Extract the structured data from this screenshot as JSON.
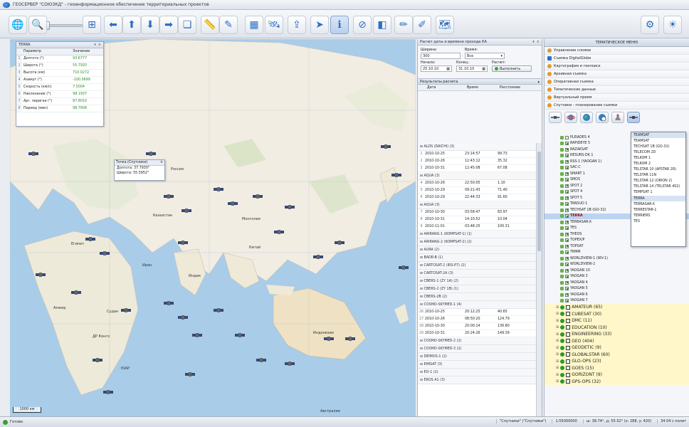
{
  "window": {
    "title": "ГЕОСЕРВЕР \"СОЮЗКД\" - геоинформационное обеспечение территориальных проектов"
  },
  "colors": {
    "accent": "#2e6fc0",
    "selected_text": "#b00000",
    "value_green": "#2a8a2a",
    "highlight_row": "#bcd3f2"
  },
  "toolbar": {
    "icons": [
      "globe-icon",
      "zoom-icon",
      "zoom-extent-icon",
      "arrow-left-icon",
      "arrow-up-icon",
      "arrow-down-icon",
      "arrow-right-icon",
      "layers-icon",
      "ruler-icon",
      "measure-icon",
      "grid-icon",
      "satellite-icon",
      "export-icon",
      "send-icon",
      "info-icon",
      "cancel-icon",
      "overlay-icon",
      "draw-icon",
      "map-edit-icon",
      "map-icon",
      "config-icon",
      "weather-icon"
    ]
  },
  "sat_panel": {
    "title": "TERRA",
    "col_param": "Параметр",
    "col_value": "Значение",
    "rows": [
      {
        "idx": "1",
        "param": "Долгота (°)",
        "value": "93.6777"
      },
      {
        "idx": "2",
        "param": "Широта (°)",
        "value": "55.7920"
      },
      {
        "idx": "3",
        "param": "Высота (км)",
        "value": "710.0272"
      },
      {
        "idx": "4",
        "param": "Азимут (°)",
        "value": "-100.0699"
      },
      {
        "idx": "5",
        "param": "Скорость (км/с)",
        "value": "7.5004"
      },
      {
        "idx": "6",
        "param": "Наклонение (°)",
        "value": "98.1937"
      },
      {
        "idx": "7",
        "param": "Арг. перигея (°)",
        "value": "87.8010"
      },
      {
        "idx": "8",
        "param": "Период (мин)",
        "value": "98.7608"
      }
    ]
  },
  "tooltip": {
    "title": "Точка (Спутники)",
    "line1": "Долгота: 37.7930°",
    "line2": "Широта: 55.5952°"
  },
  "map": {
    "scale": "1000 км",
    "places": [
      "Россия",
      "Казахстан",
      "Монголия",
      "Китай",
      "Индия",
      "Индонезия",
      "Австралия",
      "Египет",
      "Алжир",
      "ДР Конго",
      "Судан",
      "ЮАР",
      "Иран"
    ]
  },
  "calc_panel": {
    "title": "Расчет даты и времени прохода КА",
    "width_label": "Ширина:",
    "width_value": "300",
    "time_label": "Время:",
    "time_value": "Все",
    "start_label": "Начало:",
    "start_value": "25.10.10",
    "end_label": "Конец:",
    "end_value": "31.10.10",
    "calc_label": "Расчет:",
    "calc_button": "Выполнить",
    "results_title": "Результаты расчета",
    "col_date": "Дата",
    "col_time": "Время",
    "col_dist": "Расстояние",
    "results": [
      {
        "group": "ALOS (DAICHI) (3)",
        "rows": [
          [
            "1",
            "2010-10-25",
            "23:14:57",
            "99.73"
          ],
          [
            "2",
            "2010-10-26",
            "12:43:12",
            "35.32"
          ],
          [
            "3",
            "2010-10-31",
            "12:45:08",
            "67.08"
          ]
        ]
      },
      {
        "group": "AQUA (3)",
        "rows": [
          [
            "4",
            "2010-10-26",
            "22:50:05",
            "1.10"
          ],
          [
            "5",
            "2010-10-29",
            "09:21:43",
            "71.40"
          ],
          [
            "6",
            "2010-10-29",
            "22:44:33",
            "91.60"
          ]
        ]
      },
      {
        "group": "AQUA (3)",
        "rows": [
          [
            "7",
            "2010-10-30",
            "03:58:47",
            "83.97"
          ],
          [
            "8",
            "2010-10-31",
            "14:10:52",
            "10.04"
          ],
          [
            "9",
            "2010-11-01",
            "03:48:25",
            "100.31"
          ]
        ]
      },
      {
        "group": "ARIRANG-1 (KOMPSAT-1) (1)",
        "rows": []
      },
      {
        "group": "ARIRANG-2 (KOMPSAT-2) (2)",
        "rows": []
      },
      {
        "group": "AURA (2)",
        "rows": []
      },
      {
        "group": "BADR-B (1)",
        "rows": []
      },
      {
        "group": "CARTOSAT-2 (IRS-P7) (2)",
        "rows": []
      },
      {
        "group": "CARTOSAT-2A (3)",
        "rows": []
      },
      {
        "group": "CBERS-1 (ZY 1A) (2)",
        "rows": []
      },
      {
        "group": "CBERS-2 (ZY 1B) (1)",
        "rows": []
      },
      {
        "group": "CBERS-2B (2)",
        "rows": []
      },
      {
        "group": "COSMO-SKYMED-1 (4)",
        "rows": [
          [
            "26",
            "2010-10-25",
            "20:12:25",
            "40.65"
          ],
          [
            "27",
            "2010-10-26",
            "08:50:20",
            "124.79"
          ],
          [
            "28",
            "2010-10-30",
            "20:00:14",
            "136.80"
          ],
          [
            "29",
            "2010-10-31",
            "20:24:26",
            "149.39"
          ]
        ]
      },
      {
        "group": "COSMO-SKYMED-2 (2)",
        "rows": []
      },
      {
        "group": "COSMO-SKYMED-3 (2)",
        "rows": []
      },
      {
        "group": "DEIMOS-1 (2)",
        "rows": []
      },
      {
        "group": "EMISAT (3)",
        "rows": []
      },
      {
        "group": "EO-1 (2)",
        "rows": []
      },
      {
        "group": "EROS A1 (3)",
        "rows": []
      }
    ]
  },
  "theme_panel": {
    "title": "ТЕМАТИЧЕСКОЕ МЕНЮ",
    "menu": [
      {
        "label": "Управление слоями",
        "icon": "orange"
      },
      {
        "label": "Съемка DigitalGlobe",
        "icon": "blue"
      },
      {
        "label": "Картография и геопоиск",
        "icon": "orange"
      },
      {
        "label": "Архивная съемка",
        "icon": "orange"
      },
      {
        "label": "Оперативная съемка",
        "icon": "orange"
      },
      {
        "label": "Тематические данные",
        "icon": "orange"
      },
      {
        "label": "Виртуальный прием",
        "icon": "orange"
      },
      {
        "label": "Спутники - планирование съемки",
        "icon": "orange"
      }
    ],
    "tree_items": [
      {
        "label": "PLEIADES 4",
        "checked": false,
        "selected": false
      },
      {
        "label": "RAPIDEYE 5",
        "checked": true,
        "selected": false
      },
      {
        "label": "RAZAKSAT",
        "checked": true,
        "selected": false
      },
      {
        "label": "RESURS-DK 1",
        "checked": true,
        "selected": false
      },
      {
        "label": "RSS-1 (YAOGAN 1)",
        "checked": true,
        "selected": false
      },
      {
        "label": "SAC-C",
        "checked": true,
        "selected": false
      },
      {
        "label": "SMART 1",
        "checked": true,
        "selected": false
      },
      {
        "label": "SMOS",
        "checked": true,
        "selected": false
      },
      {
        "label": "SPOT 2",
        "checked": true,
        "selected": false
      },
      {
        "label": "SPOT 4",
        "checked": true,
        "selected": false
      },
      {
        "label": "SPOT 5",
        "checked": true,
        "selected": false
      },
      {
        "label": "TANSUO 1",
        "checked": true,
        "selected": false
      },
      {
        "label": "TECHSAT 1B (GO-32)",
        "checked": true,
        "selected": false
      },
      {
        "label": "TERRA",
        "checked": true,
        "selected": true
      },
      {
        "label": "TERRASAR-X",
        "checked": true,
        "selected": false
      },
      {
        "label": "TES",
        "checked": true,
        "selected": false
      },
      {
        "label": "THEOS",
        "checked": true,
        "selected": false
      },
      {
        "label": "TOPEX/P",
        "checked": true,
        "selected": false
      },
      {
        "label": "TOPSAT",
        "checked": true,
        "selected": false
      },
      {
        "label": "TRMM",
        "checked": true,
        "selected": false
      },
      {
        "label": "WORLDVIEW-1 (WV-1)",
        "checked": true,
        "selected": false
      },
      {
        "label": "WORLDVIEW-2",
        "checked": true,
        "selected": false
      },
      {
        "label": "YAOGAN 10",
        "checked": true,
        "selected": false
      },
      {
        "label": "YAOGAN 3",
        "checked": true,
        "selected": false
      },
      {
        "label": "YAOGAN 4",
        "checked": true,
        "selected": false
      },
      {
        "label": "YAOGAN 5",
        "checked": true,
        "selected": false
      },
      {
        "label": "YAOGAN 6",
        "checked": true,
        "selected": false
      },
      {
        "label": "YAOGAN 7",
        "checked": true,
        "selected": false
      }
    ],
    "groups": [
      "AMATEUR (65)",
      "CUBESAT (30)",
      "DMC (11)",
      "EDUCATION (10)",
      "ENGINEERING (33)",
      "GEO (404)",
      "GEODETIC (9)",
      "GLOBALSTAR (60)",
      "GLO-OPS (23)",
      "GOES (15)",
      "GORIZONT (9)",
      "GPS-OPS (32)"
    ],
    "dropdown": [
      {
        "label": "TEAMSAT",
        "hl": true
      },
      {
        "label": "TEAMSAT",
        "hl": false
      },
      {
        "label": "TECHSAT 1B (GO-32)",
        "hl": false
      },
      {
        "label": "TELECOM 2D",
        "hl": false
      },
      {
        "label": "TELKOM 1",
        "hl": false
      },
      {
        "label": "TELKOM 2",
        "hl": false
      },
      {
        "label": "TELSTAR 10 (APSTAR 2R)",
        "hl": false
      },
      {
        "label": "TELSTAR 11N",
        "hl": false
      },
      {
        "label": "TELSTAR 12 (ORION 2)",
        "hl": false
      },
      {
        "label": "TELSTAR 14 (TELSTAR 402)",
        "hl": false
      },
      {
        "label": "TEMPSAT 1",
        "hl": false
      },
      {
        "label": "TERRA",
        "hl": true
      },
      {
        "label": "TERRASAR-X",
        "hl": false
      },
      {
        "label": "TERRESTAR-1",
        "hl": false
      },
      {
        "label": "TERRIERS",
        "hl": false
      },
      {
        "label": "TES",
        "hl": false
      }
    ]
  },
  "status": {
    "ready": "Готово",
    "layer": "\"Спутники\" (\"Спутники\")",
    "scale": "1:55000000",
    "coords": "ш: 38.74°, д: 55.52° (x: 288, y: 420)",
    "extent": "34 04 с полит"
  }
}
